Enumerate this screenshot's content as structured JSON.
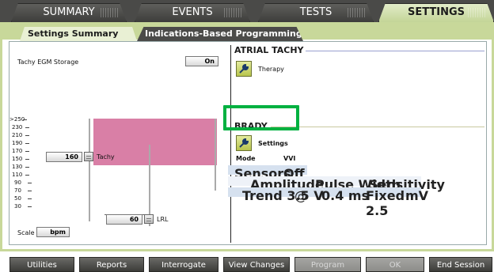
{
  "top_tabs": [
    {
      "label": "SUMMARY",
      "active": false
    },
    {
      "label": "EVENTS",
      "active": false
    },
    {
      "label": "TESTS",
      "active": false
    },
    {
      "label": "SETTINGS",
      "active": true
    }
  ],
  "sub_tabs": [
    {
      "label": "Settings Summary",
      "active": true
    },
    {
      "label": "Indications-Based Programming",
      "active": false
    }
  ],
  "left_panel": {
    "tachy_egm_label": "Tachy EGM Storage",
    "tachy_egm_value": "On",
    "axis_ticks": [
      ">250",
      "230",
      "210",
      "190",
      "170",
      "150",
      "130",
      "110",
      "90",
      "70",
      "50",
      "30"
    ],
    "tachy_value": "160",
    "tachy_label": "Tachy",
    "lrl_value": "60",
    "lrl_label": "LRL",
    "scale_label": "Scale",
    "scale_value": "bpm"
  },
  "atrial_tachy": {
    "title": "ATRIAL TACHY",
    "therapy_label": "Therapy"
  },
  "brady": {
    "title": "BRADY",
    "settings_label": "Settings",
    "mode_label": "Mode",
    "mode_value": "VVI",
    "sensors_label": "Sensors",
    "sensors_value": "Off",
    "amplitude_header": "Amplitude",
    "pulse_width_header": "Pulse Width",
    "sensitivity_header": "Sensitivity",
    "amplitude_value": "Trend 3.5 V",
    "at_symbol": "@",
    "pulse_width_value": "0.4 ms",
    "sensitivity_value": "Fixed 2.5",
    "sensitivity_unit": "mV"
  },
  "bottom_buttons": [
    {
      "label": "Utilities",
      "enabled": true
    },
    {
      "label": "Reports",
      "enabled": true
    },
    {
      "label": "Interrogate",
      "enabled": true
    },
    {
      "label": "View Changes",
      "enabled": true
    },
    {
      "label": "Program",
      "enabled": false
    },
    {
      "label": "OK",
      "enabled": false
    },
    {
      "label": "End Session",
      "enabled": true
    }
  ],
  "icons": {
    "therapy": "wrench-icon",
    "settings": "wrench-icon"
  },
  "colors": {
    "tab_active": "#c3d597",
    "tachy_zone": "#d97fa6",
    "highlight": "#00b140"
  }
}
